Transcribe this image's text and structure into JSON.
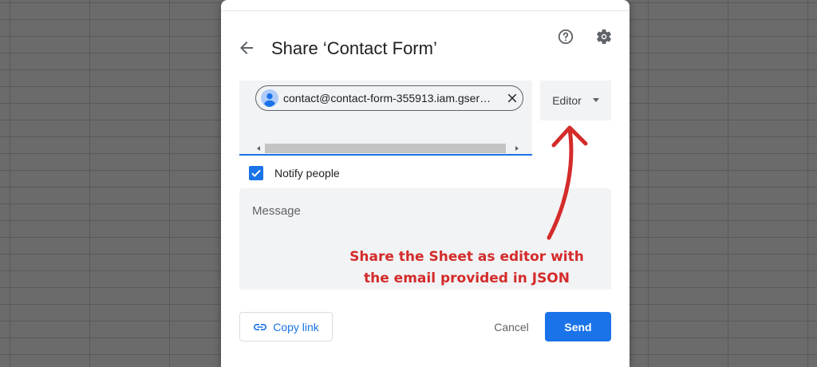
{
  "dialog": {
    "title": "Share ‘Contact Form’",
    "icons": {
      "back": "arrow-left-icon",
      "help": "help-circle-icon",
      "settings": "gear-icon"
    }
  },
  "recipients": {
    "chips": [
      {
        "label": "contact@contact-form-355913.iam.gser…",
        "avatar": "person-icon",
        "remove_icon": "close-icon"
      }
    ]
  },
  "role": {
    "label": "Editor",
    "icon": "caret-down-icon"
  },
  "notify": {
    "label": "Notify people",
    "checked": true
  },
  "message": {
    "placeholder": "Message"
  },
  "footer": {
    "copy_link_label": "Copy link",
    "copy_link_icon": "link-icon",
    "cancel_label": "Cancel",
    "send_label": "Send"
  },
  "annotation": {
    "lines": [
      "Share the Sheet as editor with",
      "the email provided in JSON"
    ],
    "color": "#d42b2b"
  },
  "colors": {
    "accent": "#1a73e8",
    "field_bg": "#f1f3f4",
    "backdrop": "#6b6b6b"
  }
}
